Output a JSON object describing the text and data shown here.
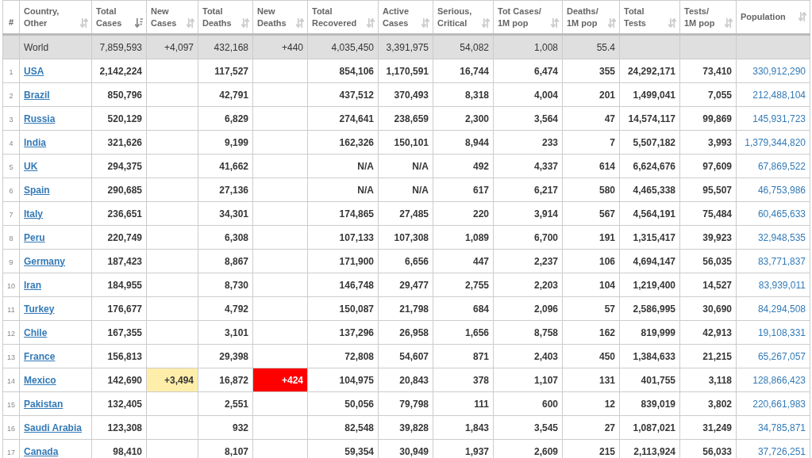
{
  "table": {
    "columns": [
      {
        "kind": "index",
        "label": "#"
      },
      {
        "kind": "data",
        "label": "Country,\nOther",
        "sorted": false
      },
      {
        "kind": "data",
        "label": "Total\nCases",
        "sorted": true
      },
      {
        "kind": "data",
        "label": "New\nCases",
        "sorted": false
      },
      {
        "kind": "data",
        "label": "Total\nDeaths",
        "sorted": false
      },
      {
        "kind": "data",
        "label": "New\nDeaths",
        "sorted": false
      },
      {
        "kind": "data",
        "label": "Total\nRecovered",
        "sorted": false
      },
      {
        "kind": "data",
        "label": "Active\nCases",
        "sorted": false
      },
      {
        "kind": "data",
        "label": "Serious,\nCritical",
        "sorted": false
      },
      {
        "kind": "data",
        "label": "Tot Cases/\n1M pop",
        "sorted": false
      },
      {
        "kind": "data",
        "label": "Deaths/\n1M pop",
        "sorted": false
      },
      {
        "kind": "data",
        "label": "Total\nTests",
        "sorted": false
      },
      {
        "kind": "data",
        "label": "Tests/\n1M pop",
        "sorted": false
      },
      {
        "kind": "data",
        "label": "Population",
        "sorted": false
      }
    ],
    "rows": [
      {
        "kind": "total",
        "country": "World",
        "new_cases_highlighted": false,
        "new_deaths_highlighted": false,
        "total_cases": "7,859,593",
        "new_cases": "+4,097",
        "total_deaths": "432,168",
        "new_deaths": "+440",
        "total_recovered": "4,035,450",
        "active_cases": "3,391,975",
        "serious_critical": "54,082",
        "tot_cases_per_1m": "1,008",
        "deaths_per_1m": "55.4"
      },
      {
        "kind": "country",
        "rank": "1",
        "country": "USA",
        "new_cases_highlighted": false,
        "new_deaths_highlighted": false,
        "total_cases": "2,142,224",
        "total_deaths": "117,527",
        "total_recovered": "854,106",
        "active_cases": "1,170,591",
        "serious_critical": "16,744",
        "tot_cases_per_1m": "6,474",
        "deaths_per_1m": "355",
        "total_tests": "24,292,171",
        "tests_per_1m": "73,410",
        "population": "330,912,290"
      },
      {
        "kind": "country",
        "rank": "2",
        "country": "Brazil",
        "new_cases_highlighted": false,
        "new_deaths_highlighted": false,
        "total_cases": "850,796",
        "total_deaths": "42,791",
        "total_recovered": "437,512",
        "active_cases": "370,493",
        "serious_critical": "8,318",
        "tot_cases_per_1m": "4,004",
        "deaths_per_1m": "201",
        "total_tests": "1,499,041",
        "tests_per_1m": "7,055",
        "population": "212,488,104"
      },
      {
        "kind": "country",
        "rank": "3",
        "country": "Russia",
        "new_cases_highlighted": false,
        "new_deaths_highlighted": false,
        "total_cases": "520,129",
        "total_deaths": "6,829",
        "total_recovered": "274,641",
        "active_cases": "238,659",
        "serious_critical": "2,300",
        "tot_cases_per_1m": "3,564",
        "deaths_per_1m": "47",
        "total_tests": "14,574,117",
        "tests_per_1m": "99,869",
        "population": "145,931,723"
      },
      {
        "kind": "country",
        "rank": "4",
        "country": "India",
        "new_cases_highlighted": false,
        "new_deaths_highlighted": false,
        "total_cases": "321,626",
        "total_deaths": "9,199",
        "total_recovered": "162,326",
        "active_cases": "150,101",
        "serious_critical": "8,944",
        "tot_cases_per_1m": "233",
        "deaths_per_1m": "7",
        "total_tests": "5,507,182",
        "tests_per_1m": "3,993",
        "population": "1,379,344,820"
      },
      {
        "kind": "country",
        "rank": "5",
        "country": "UK",
        "new_cases_highlighted": false,
        "new_deaths_highlighted": false,
        "total_cases": "294,375",
        "total_deaths": "41,662",
        "total_recovered": "N/A",
        "active_cases": "N/A",
        "serious_critical": "492",
        "tot_cases_per_1m": "4,337",
        "deaths_per_1m": "614",
        "total_tests": "6,624,676",
        "tests_per_1m": "97,609",
        "population": "67,869,522"
      },
      {
        "kind": "country",
        "rank": "6",
        "country": "Spain",
        "new_cases_highlighted": false,
        "new_deaths_highlighted": false,
        "total_cases": "290,685",
        "total_deaths": "27,136",
        "total_recovered": "N/A",
        "active_cases": "N/A",
        "serious_critical": "617",
        "tot_cases_per_1m": "6,217",
        "deaths_per_1m": "580",
        "total_tests": "4,465,338",
        "tests_per_1m": "95,507",
        "population": "46,753,986"
      },
      {
        "kind": "country",
        "rank": "7",
        "country": "Italy",
        "new_cases_highlighted": false,
        "new_deaths_highlighted": false,
        "total_cases": "236,651",
        "total_deaths": "34,301",
        "total_recovered": "174,865",
        "active_cases": "27,485",
        "serious_critical": "220",
        "tot_cases_per_1m": "3,914",
        "deaths_per_1m": "567",
        "total_tests": "4,564,191",
        "tests_per_1m": "75,484",
        "population": "60,465,633"
      },
      {
        "kind": "country",
        "rank": "8",
        "country": "Peru",
        "new_cases_highlighted": false,
        "new_deaths_highlighted": false,
        "total_cases": "220,749",
        "total_deaths": "6,308",
        "total_recovered": "107,133",
        "active_cases": "107,308",
        "serious_critical": "1,089",
        "tot_cases_per_1m": "6,700",
        "deaths_per_1m": "191",
        "total_tests": "1,315,417",
        "tests_per_1m": "39,923",
        "population": "32,948,535"
      },
      {
        "kind": "country",
        "rank": "9",
        "country": "Germany",
        "new_cases_highlighted": false,
        "new_deaths_highlighted": false,
        "total_cases": "187,423",
        "total_deaths": "8,867",
        "total_recovered": "171,900",
        "active_cases": "6,656",
        "serious_critical": "447",
        "tot_cases_per_1m": "2,237",
        "deaths_per_1m": "106",
        "total_tests": "4,694,147",
        "tests_per_1m": "56,035",
        "population": "83,771,837"
      },
      {
        "kind": "country",
        "rank": "10",
        "country": "Iran",
        "new_cases_highlighted": false,
        "new_deaths_highlighted": false,
        "total_cases": "184,955",
        "total_deaths": "8,730",
        "total_recovered": "146,748",
        "active_cases": "29,477",
        "serious_critical": "2,755",
        "tot_cases_per_1m": "2,203",
        "deaths_per_1m": "104",
        "total_tests": "1,219,400",
        "tests_per_1m": "14,527",
        "population": "83,939,011"
      },
      {
        "kind": "country",
        "rank": "11",
        "country": "Turkey",
        "new_cases_highlighted": false,
        "new_deaths_highlighted": false,
        "total_cases": "176,677",
        "total_deaths": "4,792",
        "total_recovered": "150,087",
        "active_cases": "21,798",
        "serious_critical": "684",
        "tot_cases_per_1m": "2,096",
        "deaths_per_1m": "57",
        "total_tests": "2,586,995",
        "tests_per_1m": "30,690",
        "population": "84,294,508"
      },
      {
        "kind": "country",
        "rank": "12",
        "country": "Chile",
        "new_cases_highlighted": false,
        "new_deaths_highlighted": false,
        "total_cases": "167,355",
        "total_deaths": "3,101",
        "total_recovered": "137,296",
        "active_cases": "26,958",
        "serious_critical": "1,656",
        "tot_cases_per_1m": "8,758",
        "deaths_per_1m": "162",
        "total_tests": "819,999",
        "tests_per_1m": "42,913",
        "population": "19,108,331"
      },
      {
        "kind": "country",
        "rank": "13",
        "country": "France",
        "new_cases_highlighted": false,
        "new_deaths_highlighted": false,
        "total_cases": "156,813",
        "total_deaths": "29,398",
        "total_recovered": "72,808",
        "active_cases": "54,607",
        "serious_critical": "871",
        "tot_cases_per_1m": "2,403",
        "deaths_per_1m": "450",
        "total_tests": "1,384,633",
        "tests_per_1m": "21,215",
        "population": "65,267,057"
      },
      {
        "kind": "country",
        "rank": "14",
        "country": "Mexico",
        "new_cases_highlighted": true,
        "new_deaths_highlighted": true,
        "total_cases": "142,690",
        "new_cases": "+3,494",
        "total_deaths": "16,872",
        "new_deaths": "+424",
        "total_recovered": "104,975",
        "active_cases": "20,843",
        "serious_critical": "378",
        "tot_cases_per_1m": "1,107",
        "deaths_per_1m": "131",
        "total_tests": "401,755",
        "tests_per_1m": "3,118",
        "population": "128,866,423"
      },
      {
        "kind": "country",
        "rank": "15",
        "country": "Pakistan",
        "new_cases_highlighted": false,
        "new_deaths_highlighted": false,
        "total_cases": "132,405",
        "total_deaths": "2,551",
        "total_recovered": "50,056",
        "active_cases": "79,798",
        "serious_critical": "111",
        "tot_cases_per_1m": "600",
        "deaths_per_1m": "12",
        "total_tests": "839,019",
        "tests_per_1m": "3,802",
        "population": "220,661,983"
      },
      {
        "kind": "country",
        "rank": "16",
        "country": "Saudi Arabia",
        "new_cases_highlighted": false,
        "new_deaths_highlighted": false,
        "total_cases": "123,308",
        "total_deaths": "932",
        "total_recovered": "82,548",
        "active_cases": "39,828",
        "serious_critical": "1,843",
        "tot_cases_per_1m": "3,545",
        "deaths_per_1m": "27",
        "total_tests": "1,087,021",
        "tests_per_1m": "31,249",
        "population": "34,785,871"
      },
      {
        "kind": "country",
        "rank": "17",
        "country": "Canada",
        "new_cases_highlighted": false,
        "new_deaths_highlighted": false,
        "total_cases": "98,410",
        "total_deaths": "8,107",
        "total_recovered": "59,354",
        "active_cases": "30,949",
        "serious_critical": "1,937",
        "tot_cases_per_1m": "2,609",
        "deaths_per_1m": "215",
        "total_tests": "2,113,924",
        "tests_per_1m": "56,033",
        "population": "37,726,251"
      }
    ]
  }
}
